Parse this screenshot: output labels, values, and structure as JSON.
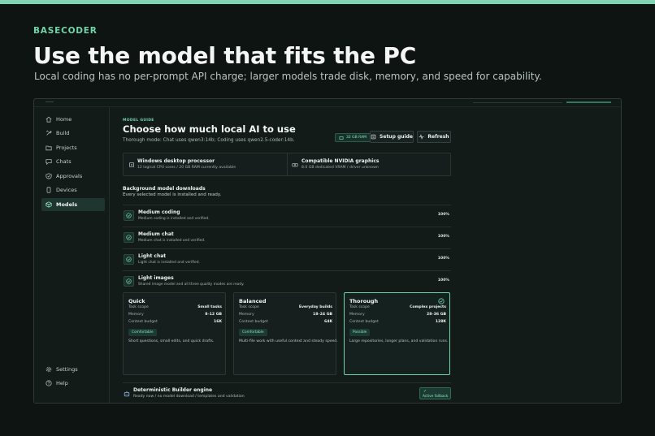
{
  "brand": "BASECODER",
  "headline": "Use the model that fits the PC",
  "subline": "Local coding has no per-prompt API charge; larger models trade disk, memory, and speed for capability.",
  "sidebar": {
    "items": [
      {
        "label": "Home",
        "icon": "home-icon"
      },
      {
        "label": "Build",
        "icon": "build-icon"
      },
      {
        "label": "Projects",
        "icon": "folder-icon"
      },
      {
        "label": "Chats",
        "icon": "chat-icon"
      },
      {
        "label": "Approvals",
        "icon": "shield-check-icon"
      },
      {
        "label": "Devices",
        "icon": "device-icon"
      },
      {
        "label": "Models",
        "icon": "cube-icon",
        "active": true
      }
    ],
    "bottom": [
      {
        "label": "Settings",
        "icon": "gear-icon"
      },
      {
        "label": "Help",
        "icon": "help-icon"
      }
    ]
  },
  "guide": {
    "tag": "MODEL GUIDE",
    "title": "Choose how much local AI to use",
    "subtitle": "Thorough mode: Chat uses qwen3:14b; Coding uses qwen2.5-coder:14b."
  },
  "toolbar": {
    "ram": "32 GB RAM",
    "setup_label": "Setup guide",
    "refresh_label": "Refresh"
  },
  "hardware": {
    "cpu": {
      "title": "Windows desktop processor",
      "detail": "12 logical CPU cores / 20 GB RAM currently available"
    },
    "gpu": {
      "title": "Compatible NVIDIA graphics",
      "detail": "8.0 GB dedicated VRAM / driver unknown"
    }
  },
  "downloads": {
    "title": "Background model downloads",
    "subtitle": "Every selected model is installed and ready.",
    "items": [
      {
        "name": "Medium coding",
        "desc": "Medium coding is installed and verified.",
        "pct": "100%"
      },
      {
        "name": "Medium chat",
        "desc": "Medium chat is installed and verified.",
        "pct": "100%"
      },
      {
        "name": "Light chat",
        "desc": "Light chat is installed and verified.",
        "pct": "100%"
      },
      {
        "name": "Light images",
        "desc": "Shared image model and all three quality modes are ready.",
        "pct": "100%"
      }
    ]
  },
  "modes": [
    {
      "name": "Quick",
      "scope_label": "Task scope",
      "scope": "Small tasks",
      "memory_label": "Memory",
      "memory": "8–12 GB",
      "context_label": "Context budget",
      "context": "16K",
      "badge": "Comfortable",
      "desc": "Short questions, small edits, and quick drafts.",
      "selected": false
    },
    {
      "name": "Balanced",
      "scope_label": "Task scope",
      "scope": "Everyday builds",
      "memory_label": "Memory",
      "memory": "18–24 GB",
      "context_label": "Context budget",
      "context": "64K",
      "badge": "Comfortable",
      "desc": "Multi-file work with useful context and steady speed.",
      "selected": false
    },
    {
      "name": "Thorough",
      "scope_label": "Task scope",
      "scope": "Complex projects",
      "memory_label": "Memory",
      "memory": "28–36 GB",
      "context_label": "Context budget",
      "context": "128K",
      "badge": "Possible",
      "desc": "Large repositories, longer plans, and validation runs.",
      "selected": true
    }
  ],
  "engine": {
    "name": "Deterministic Builder engine",
    "desc": "Ready now / no model download / templates and validation",
    "fallback": "Active fallback"
  },
  "colors": {
    "accent": "#6fd4ac",
    "background": "#0d1412",
    "panel": "#131b19"
  }
}
